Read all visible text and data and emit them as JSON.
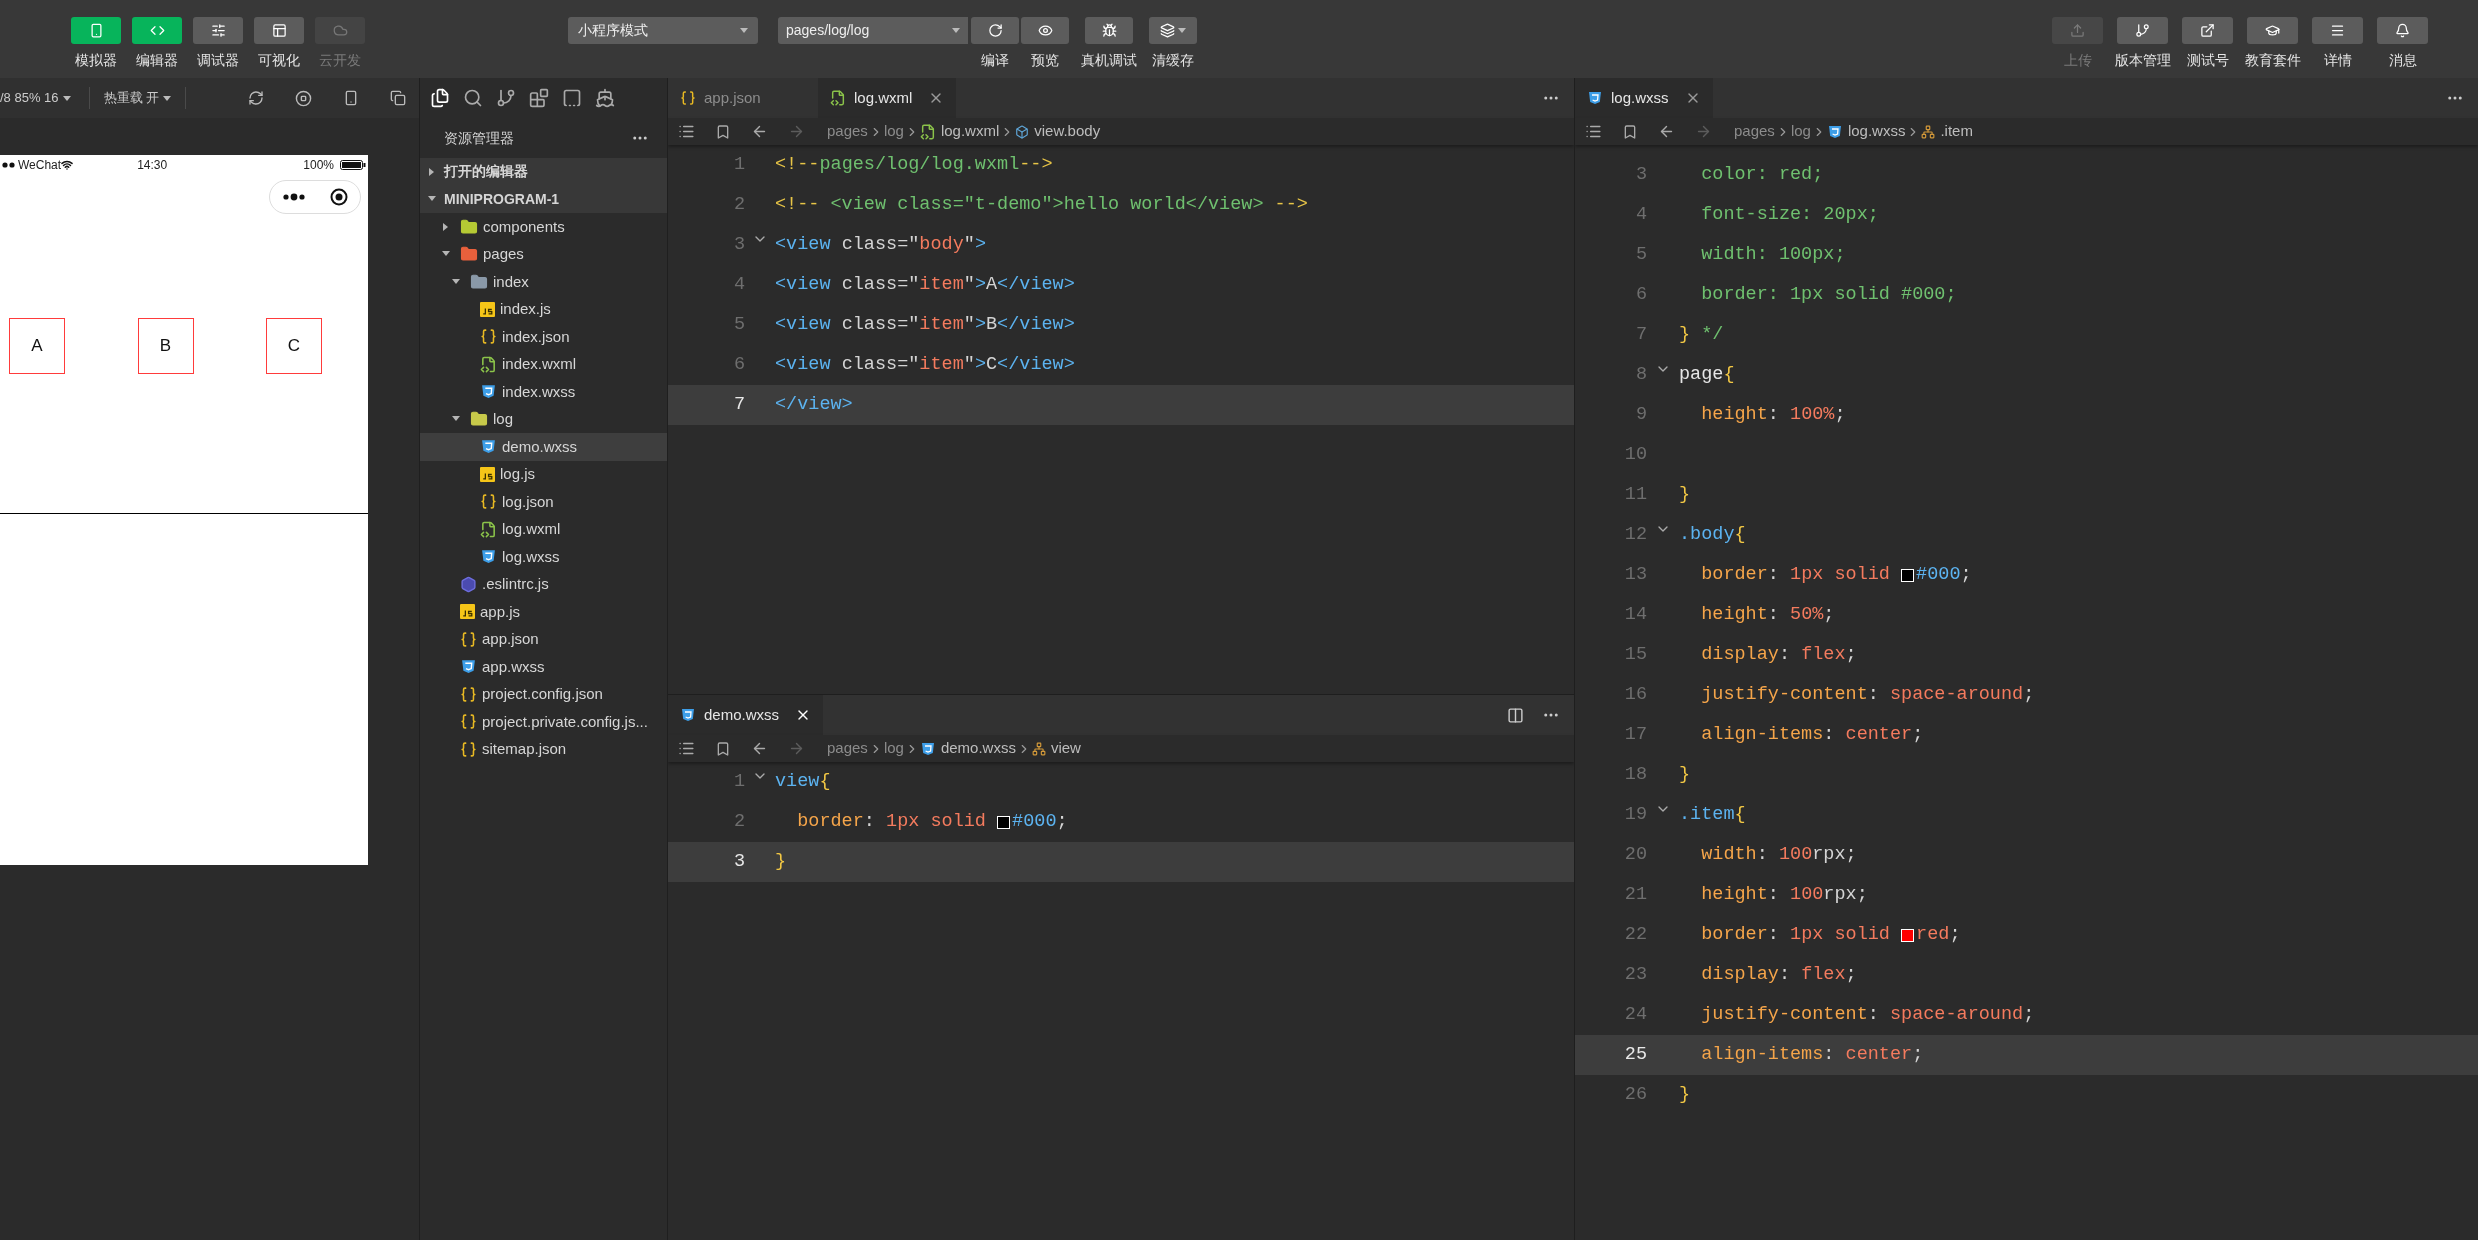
{
  "toolbar": {
    "left_buttons": [
      {
        "label": "模拟器",
        "selected": true,
        "disabled": false
      },
      {
        "label": "编辑器",
        "selected": true,
        "disabled": false
      },
      {
        "label": "调试器",
        "selected": false,
        "disabled": false
      },
      {
        "label": "可视化",
        "selected": false,
        "disabled": false
      },
      {
        "label": "云开发",
        "selected": false,
        "disabled": true
      }
    ],
    "mode_select": "小程序模式",
    "page_select": "pages/log/log",
    "actions": [
      {
        "label": "编译",
        "dropdown": false
      },
      {
        "label": "预览",
        "dropdown": false
      },
      {
        "label": "真机调试",
        "dropdown": false
      },
      {
        "label": "清缓存",
        "dropdown": true
      }
    ],
    "right_buttons": [
      {
        "label": "上传",
        "disabled": true
      },
      {
        "label": "版本管理",
        "disabled": false
      },
      {
        "label": "测试号",
        "disabled": false
      },
      {
        "label": "教育套件",
        "disabled": false
      },
      {
        "label": "详情",
        "disabled": false
      },
      {
        "label": "消息",
        "disabled": false
      }
    ]
  },
  "simulator": {
    "device": "/8 85% 16",
    "hot_reload": "热重载 开",
    "status_bar": {
      "carrier": "WeChat",
      "time": "14:30",
      "battery": "100%"
    },
    "items": [
      "A",
      "B",
      "C"
    ]
  },
  "explorer": {
    "title": "资源管理器",
    "sections": [
      {
        "label": "打开的编辑器",
        "expanded": false
      },
      {
        "label": "MINIPROGRAM-1",
        "expanded": true,
        "children": [
          {
            "label": "components",
            "kind": "folder",
            "color": "#b5c934",
            "expanded": false,
            "selected": false
          },
          {
            "label": "pages",
            "kind": "folder",
            "color": "#e8603c",
            "expanded": true,
            "selected": false,
            "children": [
              {
                "label": "index",
                "kind": "folder",
                "color": "#8a99a8",
                "expanded": true,
                "selected": false,
                "children": [
                  {
                    "label": "index.js",
                    "kind": "js",
                    "selected": false
                  },
                  {
                    "label": "index.json",
                    "kind": "json",
                    "selected": false
                  },
                  {
                    "label": "index.wxml",
                    "kind": "wxml",
                    "selected": false
                  },
                  {
                    "label": "index.wxss",
                    "kind": "wxss",
                    "selected": false
                  }
                ]
              },
              {
                "label": "log",
                "kind": "folder",
                "color": "#c7c94a",
                "expanded": true,
                "selected": false,
                "children": [
                  {
                    "label": "demo.wxss",
                    "kind": "wxss",
                    "selected": true
                  },
                  {
                    "label": "log.js",
                    "kind": "js",
                    "selected": false
                  },
                  {
                    "label": "log.json",
                    "kind": "json",
                    "selected": false
                  },
                  {
                    "label": "log.wxml",
                    "kind": "wxml",
                    "selected": false
                  },
                  {
                    "label": "log.wxss",
                    "kind": "wxss",
                    "selected": false
                  }
                ]
              }
            ]
          },
          {
            "label": ".eslintrc.js",
            "kind": "eslint",
            "selected": false
          },
          {
            "label": "app.js",
            "kind": "js",
            "selected": false
          },
          {
            "label": "app.json",
            "kind": "json",
            "selected": false
          },
          {
            "label": "app.wxss",
            "kind": "wxss",
            "selected": false
          },
          {
            "label": "project.config.json",
            "kind": "json",
            "selected": false
          },
          {
            "label": "project.private.config.js...",
            "kind": "json",
            "selected": false
          },
          {
            "label": "sitemap.json",
            "kind": "json",
            "selected": false
          }
        ]
      }
    ]
  },
  "editor_top": {
    "tabs": [
      {
        "label": "app.json",
        "kind": "json",
        "selected": false
      },
      {
        "label": "log.wxml",
        "kind": "wxml",
        "selected": true
      }
    ],
    "breadcrumb": [
      {
        "text": "pages",
        "kind": "dir"
      },
      {
        "text": "log",
        "kind": "dir"
      },
      {
        "text": "log.wxml",
        "kind": "wxml"
      },
      {
        "text": "view.body",
        "kind": "element"
      }
    ],
    "lines": [
      {
        "number": "1",
        "current": false,
        "fold": false,
        "tokens": [
          {
            "text": "<!--",
            "kind": "cpunct"
          },
          {
            "text": "pages/log/log.wxml",
            "kind": "comment"
          },
          {
            "text": "-->",
            "kind": "cpunct"
          }
        ]
      },
      {
        "number": "2",
        "current": false,
        "fold": false,
        "tokens": [
          {
            "text": "<!-- ",
            "kind": "cpunct"
          },
          {
            "text": "<view class=\"t-demo\">hello world</view>",
            "kind": "comment"
          },
          {
            "text": " -->",
            "kind": "cpunct"
          }
        ]
      },
      {
        "number": "3",
        "current": false,
        "fold": true,
        "tokens": [
          {
            "text": "<view ",
            "kind": "tag"
          },
          {
            "text": "class=\"",
            "kind": "attr"
          },
          {
            "text": "body",
            "kind": "string"
          },
          {
            "text": "\"",
            "kind": "attr"
          },
          {
            "text": ">",
            "kind": "tag"
          }
        ]
      },
      {
        "number": "4",
        "current": false,
        "fold": false,
        "tokens": [
          {
            "text": "<view ",
            "kind": "tag"
          },
          {
            "text": "class=\"",
            "kind": "attr"
          },
          {
            "text": "item",
            "kind": "string"
          },
          {
            "text": "\"",
            "kind": "attr"
          },
          {
            "text": ">",
            "kind": "tag"
          },
          {
            "text": "A",
            "kind": "text"
          },
          {
            "text": "</view>",
            "kind": "tag"
          }
        ]
      },
      {
        "number": "5",
        "current": false,
        "fold": false,
        "tokens": [
          {
            "text": "<view ",
            "kind": "tag"
          },
          {
            "text": "class=\"",
            "kind": "attr"
          },
          {
            "text": "item",
            "kind": "string"
          },
          {
            "text": "\"",
            "kind": "attr"
          },
          {
            "text": ">",
            "kind": "tag"
          },
          {
            "text": "B",
            "kind": "text"
          },
          {
            "text": "</view>",
            "kind": "tag"
          }
        ]
      },
      {
        "number": "6",
        "current": false,
        "fold": false,
        "tokens": [
          {
            "text": "<view ",
            "kind": "tag"
          },
          {
            "text": "class=\"",
            "kind": "attr"
          },
          {
            "text": "item",
            "kind": "string"
          },
          {
            "text": "\"",
            "kind": "attr"
          },
          {
            "text": ">",
            "kind": "tag"
          },
          {
            "text": "C",
            "kind": "text"
          },
          {
            "text": "</view>",
            "kind": "tag"
          }
        ]
      },
      {
        "number": "7",
        "current": true,
        "fold": false,
        "tokens": [
          {
            "text": "</view>",
            "kind": "tag"
          }
        ]
      }
    ]
  },
  "editor_bottom": {
    "tabs": [
      {
        "label": "demo.wxss",
        "kind": "wxss",
        "selected": true
      }
    ],
    "breadcrumb": [
      {
        "text": "pages",
        "kind": "dir"
      },
      {
        "text": "log",
        "kind": "dir"
      },
      {
        "text": "demo.wxss",
        "kind": "wxss"
      },
      {
        "text": "view",
        "kind": "selector"
      }
    ],
    "lines": [
      {
        "number": "1",
        "current": false,
        "fold": true,
        "tokens": [
          {
            "text": "view",
            "kind": "tag"
          },
          {
            "text": "{",
            "kind": "bracket"
          }
        ]
      },
      {
        "number": "2",
        "current": false,
        "fold": false,
        "tokens": [
          {
            "text": "  border",
            "kind": "prop"
          },
          {
            "text": ": ",
            "kind": "punct"
          },
          {
            "text": "1px solid ",
            "kind": "value"
          },
          {
            "kind": "swatch",
            "color": "#000000"
          },
          {
            "text": "#000",
            "kind": "hex"
          },
          {
            "text": ";",
            "kind": "punct"
          }
        ]
      },
      {
        "number": "3",
        "current": true,
        "fold": false,
        "tokens": [
          {
            "text": "}",
            "kind": "bracket"
          }
        ]
      }
    ]
  },
  "editor_right": {
    "tabs": [
      {
        "label": "log.wxss",
        "kind": "wxss",
        "selected": true
      }
    ],
    "breadcrumb": [
      {
        "text": "pages",
        "kind": "dir"
      },
      {
        "text": "log",
        "kind": "dir"
      },
      {
        "text": "log.wxss",
        "kind": "wxss"
      },
      {
        "text": ".item",
        "kind": "selector"
      }
    ],
    "lines": [
      {
        "number": "3",
        "current": false,
        "fold": false,
        "tokens": [
          {
            "text": "  color: red;",
            "kind": "comment"
          }
        ]
      },
      {
        "number": "4",
        "current": false,
        "fold": false,
        "tokens": [
          {
            "text": "  font-size: 20px;",
            "kind": "comment"
          }
        ]
      },
      {
        "number": "5",
        "current": false,
        "fold": false,
        "tokens": [
          {
            "text": "  width: 100px;",
            "kind": "comment"
          }
        ]
      },
      {
        "number": "6",
        "current": false,
        "fold": false,
        "tokens": [
          {
            "text": "  border: 1px solid #000;",
            "kind": "comment"
          }
        ]
      },
      {
        "number": "7",
        "current": false,
        "fold": false,
        "tokens": [
          {
            "text": "}",
            "kind": "bracket"
          },
          {
            "text": " */",
            "kind": "comment"
          }
        ]
      },
      {
        "number": "8",
        "current": false,
        "fold": true,
        "tokens": [
          {
            "text": "page",
            "kind": "selector"
          },
          {
            "text": "{",
            "kind": "bracket"
          }
        ]
      },
      {
        "number": "9",
        "current": false,
        "fold": false,
        "tokens": [
          {
            "text": "  height",
            "kind": "prop"
          },
          {
            "text": ": ",
            "kind": "punct"
          },
          {
            "text": "100%",
            "kind": "value"
          },
          {
            "text": ";",
            "kind": "punct"
          }
        ]
      },
      {
        "number": "10",
        "current": false,
        "fold": false
      },
      {
        "number": "11",
        "current": false,
        "fold": false,
        "tokens": [
          {
            "text": "}",
            "kind": "bracket"
          }
        ]
      },
      {
        "number": "12",
        "current": false,
        "fold": true,
        "tokens": [
          {
            "text": ".body",
            "kind": "class"
          },
          {
            "text": "{",
            "kind": "bracket"
          }
        ]
      },
      {
        "number": "13",
        "current": false,
        "fold": false,
        "tokens": [
          {
            "text": "  border",
            "kind": "prop"
          },
          {
            "text": ": ",
            "kind": "punct"
          },
          {
            "text": "1px solid ",
            "kind": "value"
          },
          {
            "kind": "swatch",
            "color": "#000000"
          },
          {
            "text": "#000",
            "kind": "hex"
          },
          {
            "text": ";",
            "kind": "punct"
          }
        ]
      },
      {
        "number": "14",
        "current": false,
        "fold": false,
        "tokens": [
          {
            "text": "  height",
            "kind": "prop"
          },
          {
            "text": ": ",
            "kind": "punct"
          },
          {
            "text": "50%",
            "kind": "value"
          },
          {
            "text": ";",
            "kind": "punct"
          }
        ]
      },
      {
        "number": "15",
        "current": false,
        "fold": false,
        "tokens": [
          {
            "text": "  display",
            "kind": "prop"
          },
          {
            "text": ": ",
            "kind": "punct"
          },
          {
            "text": "flex",
            "kind": "value"
          },
          {
            "text": ";",
            "kind": "punct"
          }
        ]
      },
      {
        "number": "16",
        "current": false,
        "fold": false,
        "tokens": [
          {
            "text": "  justify-content",
            "kind": "prop"
          },
          {
            "text": ": ",
            "kind": "punct"
          },
          {
            "text": "space-around",
            "kind": "value"
          },
          {
            "text": ";",
            "kind": "punct"
          }
        ]
      },
      {
        "number": "17",
        "current": false,
        "fold": false,
        "tokens": [
          {
            "text": "  align-items",
            "kind": "prop"
          },
          {
            "text": ": ",
            "kind": "punct"
          },
          {
            "text": "center",
            "kind": "value"
          },
          {
            "text": ";",
            "kind": "punct"
          }
        ]
      },
      {
        "number": "18",
        "current": false,
        "fold": false,
        "tokens": [
          {
            "text": "}",
            "kind": "bracket"
          }
        ]
      },
      {
        "number": "19",
        "current": false,
        "fold": true,
        "tokens": [
          {
            "text": ".item",
            "kind": "class"
          },
          {
            "text": "{",
            "kind": "bracket"
          }
        ]
      },
      {
        "number": "20",
        "current": false,
        "fold": false,
        "tokens": [
          {
            "text": "  width",
            "kind": "prop"
          },
          {
            "text": ": ",
            "kind": "punct"
          },
          {
            "text": "100",
            "kind": "value"
          },
          {
            "text": "rpx;",
            "kind": "punct"
          }
        ]
      },
      {
        "number": "21",
        "current": false,
        "fold": false,
        "tokens": [
          {
            "text": "  height",
            "kind": "prop"
          },
          {
            "text": ": ",
            "kind": "punct"
          },
          {
            "text": "100",
            "kind": "value"
          },
          {
            "text": "rpx;",
            "kind": "punct"
          }
        ]
      },
      {
        "number": "22",
        "current": false,
        "fold": false,
        "tokens": [
          {
            "text": "  border",
            "kind": "prop"
          },
          {
            "text": ": ",
            "kind": "punct"
          },
          {
            "text": "1px solid ",
            "kind": "value"
          },
          {
            "kind": "swatch",
            "color": "#ff0000"
          },
          {
            "text": "red",
            "kind": "value"
          },
          {
            "text": ";",
            "kind": "punct"
          }
        ]
      },
      {
        "number": "23",
        "current": false,
        "fold": false,
        "tokens": [
          {
            "text": "  display",
            "kind": "prop"
          },
          {
            "text": ": ",
            "kind": "punct"
          },
          {
            "text": "flex",
            "kind": "value"
          },
          {
            "text": ";",
            "kind": "punct"
          }
        ]
      },
      {
        "number": "24",
        "current": false,
        "fold": false,
        "tokens": [
          {
            "text": "  justify-content",
            "kind": "prop"
          },
          {
            "text": ": ",
            "kind": "punct"
          },
          {
            "text": "space-around",
            "kind": "value"
          },
          {
            "text": ";",
            "kind": "punct"
          }
        ]
      },
      {
        "number": "25",
        "current": true,
        "fold": false,
        "tokens": [
          {
            "text": "  align-items",
            "kind": "prop"
          },
          {
            "text": ": ",
            "kind": "punct"
          },
          {
            "text": "center",
            "kind": "value"
          },
          {
            "text": ";",
            "kind": "punct"
          }
        ]
      },
      {
        "number": "26",
        "current": false,
        "fold": false,
        "tokens": [
          {
            "text": "}",
            "kind": "bracket"
          }
        ]
      }
    ]
  }
}
